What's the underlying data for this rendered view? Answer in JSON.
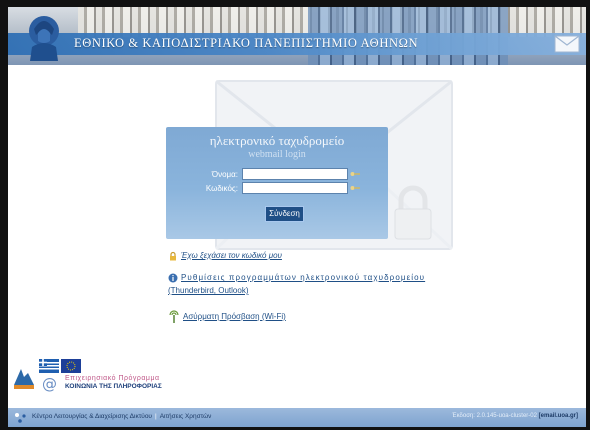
{
  "header": {
    "title": "ΕΘΝΙΚΟ & ΚΑΠΟΔΙΣΤΡΙΑΚΟ ΠΑΝΕΠΙΣΤΗΜΙΟ ΑΘΗΝΩΝ",
    "logo_icon": "athena-logo-icon",
    "mail_icon": "envelope-icon"
  },
  "login": {
    "heading": "ηλεκτρονικό ταχυδρομείο",
    "subheading": "webmail login",
    "username_label": "Όνομα:",
    "username_value": "",
    "password_label": "Κωδικός:",
    "password_value": "",
    "submit_label": "Σύνδεση",
    "key_icon": "key-icon"
  },
  "links": {
    "forgot_password": "Έχω ξεχάσει τον κωδικό μου",
    "client_settings_line1": "Ρυθμίσεις προγραμμάτων ηλεκτρονικού ταχυδρομείου",
    "client_settings_line2": "(Thunderbird, Outlook)",
    "wifi": "Ασύρματη Πρόσβαση (Wi-Fi)"
  },
  "program": {
    "title": "Επιχειρησιακό Πρόγραμμα",
    "subtitle": "ΚΟΙΝΩΝΙΑ ΤΗΣ ΠΛΗΡΟΦΟΡΙΑΣ"
  },
  "footer": {
    "left_text": "Κέντρο Λειτουργίας & Διαχείρισης Δικτύου",
    "separator": "|",
    "left_link": "Αιτήσεις Χρηστών",
    "version_text": "Έκδοση: 2.0.145-uoa-cluster-02",
    "host_text": "[email.uoa.gr]"
  },
  "colors": {
    "accent_blue": "#1f4f86",
    "login_box": "#8ab4dc",
    "bottom_bar": "#8fb0d8"
  }
}
